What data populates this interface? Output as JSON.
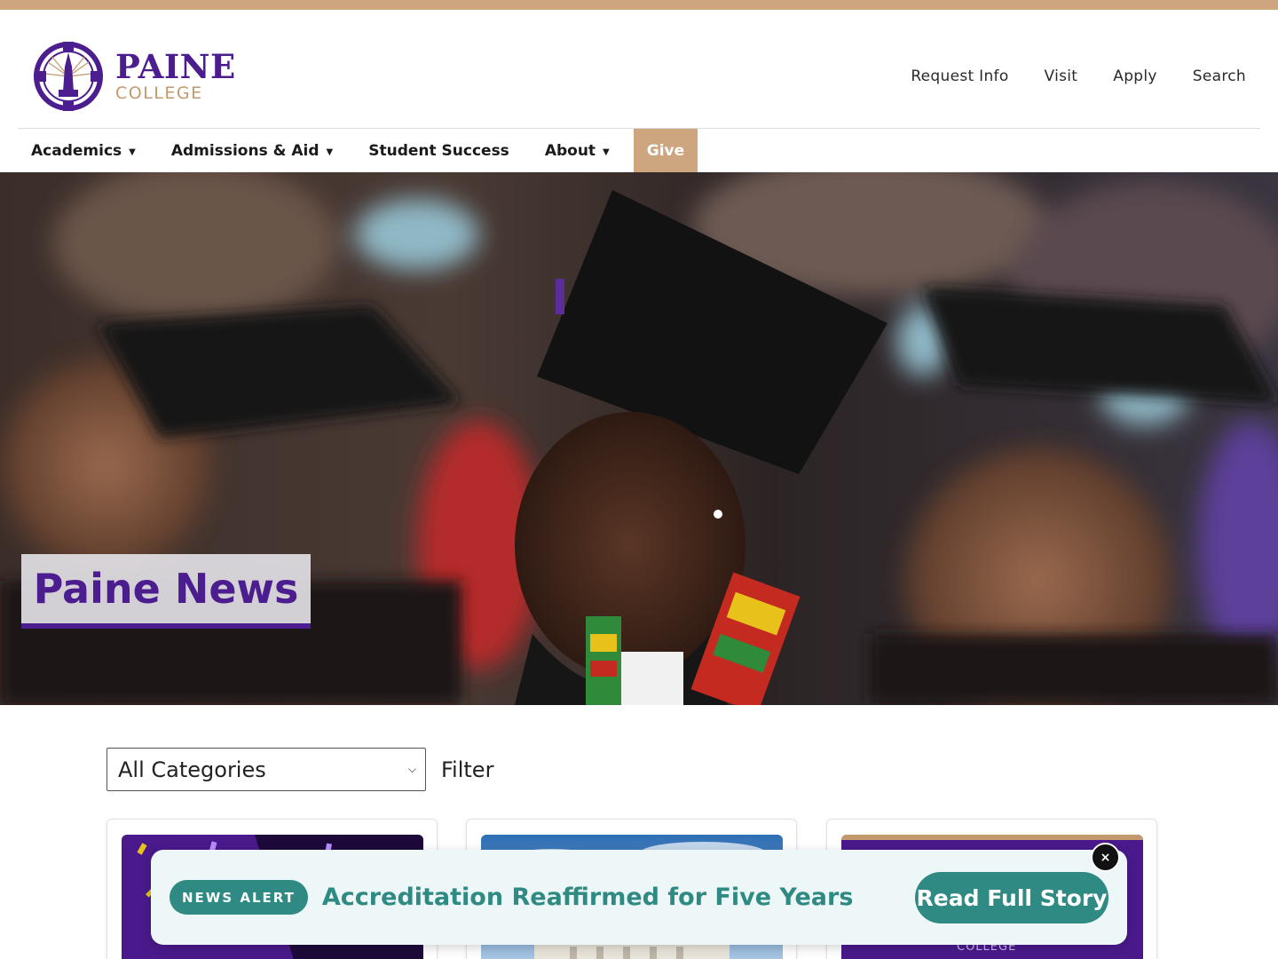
{
  "header": {
    "logo": {
      "word1": "PAINE",
      "word2": "COLLEGE"
    },
    "utility_nav": [
      {
        "label": "Request Info"
      },
      {
        "label": "Visit"
      },
      {
        "label": "Apply"
      },
      {
        "label": "Search"
      }
    ],
    "main_nav": [
      {
        "label": "Academics",
        "has_dropdown": true,
        "caret": "▼"
      },
      {
        "label": "Admissions & Aid",
        "has_dropdown": true,
        "caret": "▼"
      },
      {
        "label": "Student Success",
        "has_dropdown": false
      },
      {
        "label": "About",
        "has_dropdown": true,
        "caret": "▼"
      },
      {
        "label": "Give",
        "has_dropdown": false
      }
    ]
  },
  "hero": {
    "title": "Paine News"
  },
  "filter": {
    "select_value": "All Categories",
    "button_label": "Filter"
  },
  "alert": {
    "badge": "NEWS ALERT",
    "headline": "Accreditation Reaffirmed for Five Years",
    "cta": "Read Full Story",
    "close": "×"
  },
  "cards": {
    "card_3_caption": "COLLEGE"
  },
  "colors": {
    "brand_purple": "#4b1d8f",
    "brand_tan": "#cda57f",
    "alert_teal": "#2e8a82",
    "alert_bg": "#eef7f7"
  }
}
